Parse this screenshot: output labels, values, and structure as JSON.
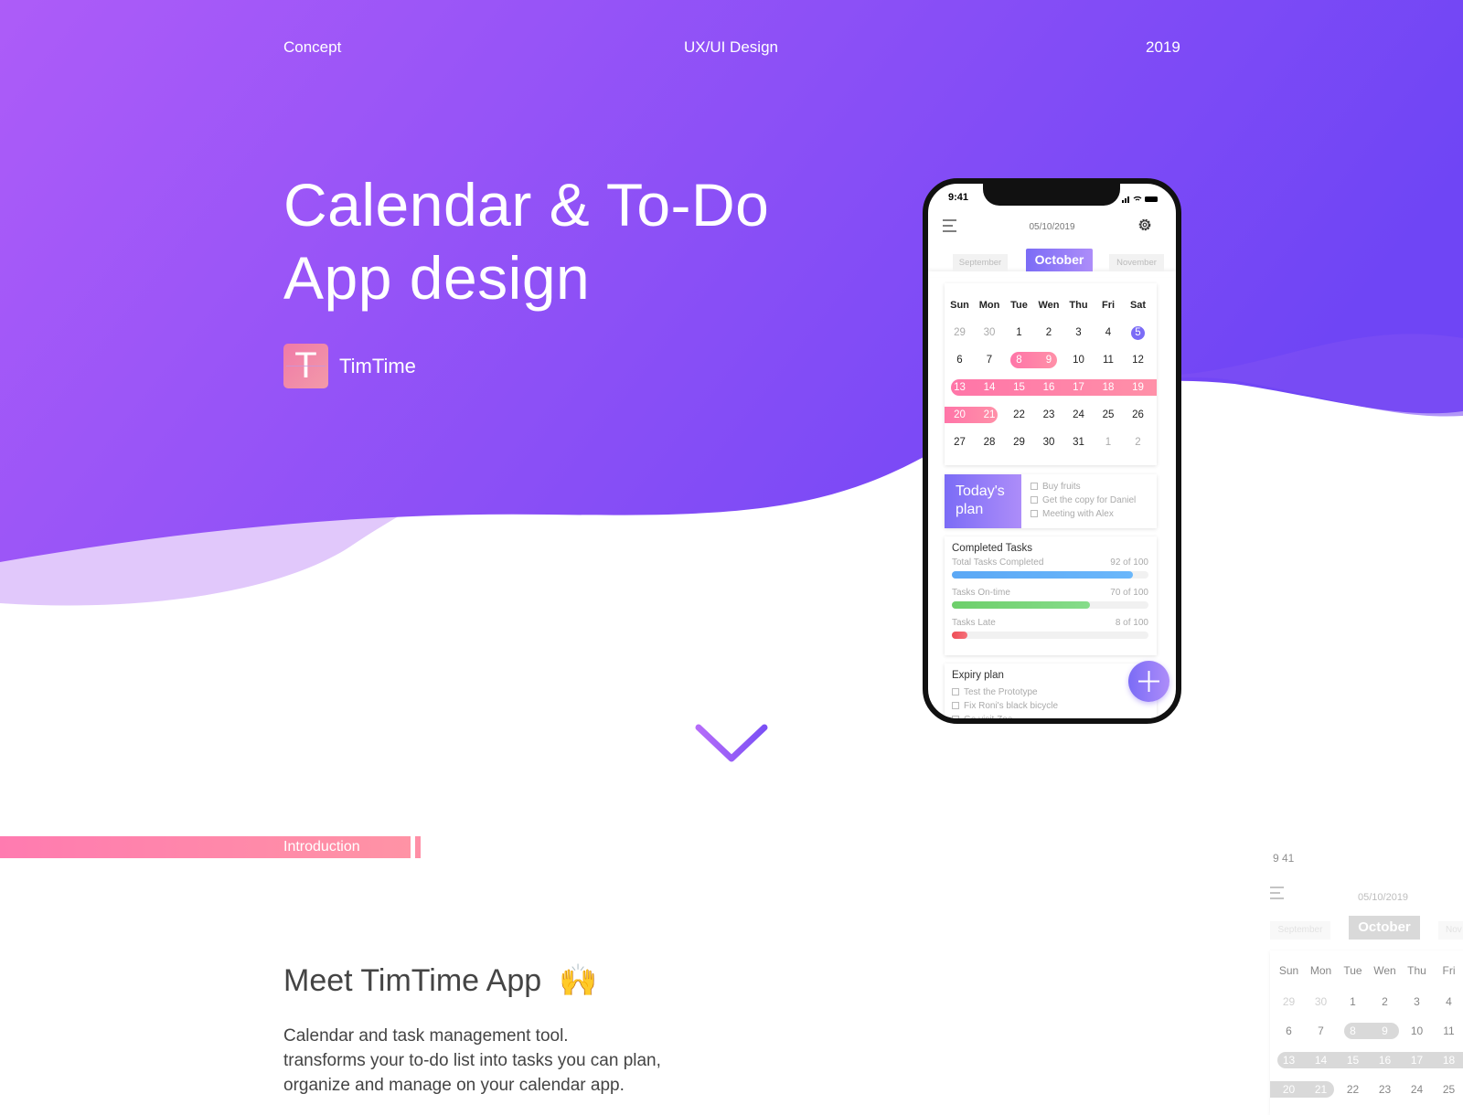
{
  "nav": {
    "left": "Concept",
    "center": "UX/UI Design",
    "right": "2019"
  },
  "hero": {
    "title_line1": "Calendar & To-Do",
    "title_line2": "App design",
    "logo_letter": "T",
    "brand": "TimTime"
  },
  "colors": {
    "hero_start": "#ad5cf8",
    "hero_end": "#6f45f5",
    "accent_pink": "#ff7bb0",
    "accent_purple": "#7b6cf6",
    "bar_blue": "#5ba8f5",
    "bar_green": "#6dcf6a",
    "bar_red": "#ee4d55"
  },
  "phone": {
    "time": "9:41",
    "date": "05/10/2019",
    "months": {
      "prev": "September",
      "current": "October",
      "next": "November"
    },
    "weekdays": [
      "Sun",
      "Mon",
      "Tue",
      "Wen",
      "Thu",
      "Fri",
      "Sat"
    ],
    "weeks": [
      [
        "29",
        "30",
        "1",
        "2",
        "3",
        "4",
        "5"
      ],
      [
        "6",
        "7",
        "8",
        "9",
        "10",
        "11",
        "12"
      ],
      [
        "13",
        "14",
        "15",
        "16",
        "17",
        "18",
        "19"
      ],
      [
        "20",
        "21",
        "22",
        "23",
        "24",
        "25",
        "26"
      ],
      [
        "27",
        "28",
        "29",
        "30",
        "31",
        "1",
        "2"
      ]
    ],
    "today_plan": {
      "title": "Today's plan",
      "items": [
        "Buy fruits",
        "Get the copy for Daniel",
        "Meeting with Alex"
      ]
    },
    "completed": {
      "title": "Completed Tasks",
      "stats": [
        {
          "label": "Total Tasks Completed",
          "value": "92 of 100",
          "percent": 92
        },
        {
          "label": "Tasks On-time",
          "value": "70 of 100",
          "percent": 70
        },
        {
          "label": "Tasks Late",
          "value": "8 of 100",
          "percent": 8
        }
      ]
    },
    "expiry": {
      "title": "Expiry plan",
      "items": [
        "Test the Prototype",
        "Fix Roni's black bicycle",
        "Go visit Zoe"
      ]
    }
  },
  "intro": {
    "label": "Introduction",
    "heading": "Meet TimTime App",
    "emoji": "🙌",
    "paragraph": [
      "Calendar and task management tool.",
      "transforms your to-do list into tasks you can plan,",
      "organize and manage on your calendar app."
    ]
  },
  "ghost": {
    "time": "9 41",
    "date": "05/10/2019",
    "prev": "September",
    "current": "October",
    "next": "Nov",
    "weekdays": [
      "Sun",
      "Mon",
      "Tue",
      "Wen",
      "Thu",
      "Fri"
    ],
    "weeks": [
      [
        "29",
        "30",
        "1",
        "2",
        "3",
        "4"
      ],
      [
        "6",
        "7",
        "8",
        "9",
        "10",
        "11"
      ],
      [
        "13",
        "14",
        "15",
        "16",
        "17",
        "18"
      ],
      [
        "20",
        "21",
        "22",
        "23",
        "24",
        "25"
      ]
    ]
  }
}
